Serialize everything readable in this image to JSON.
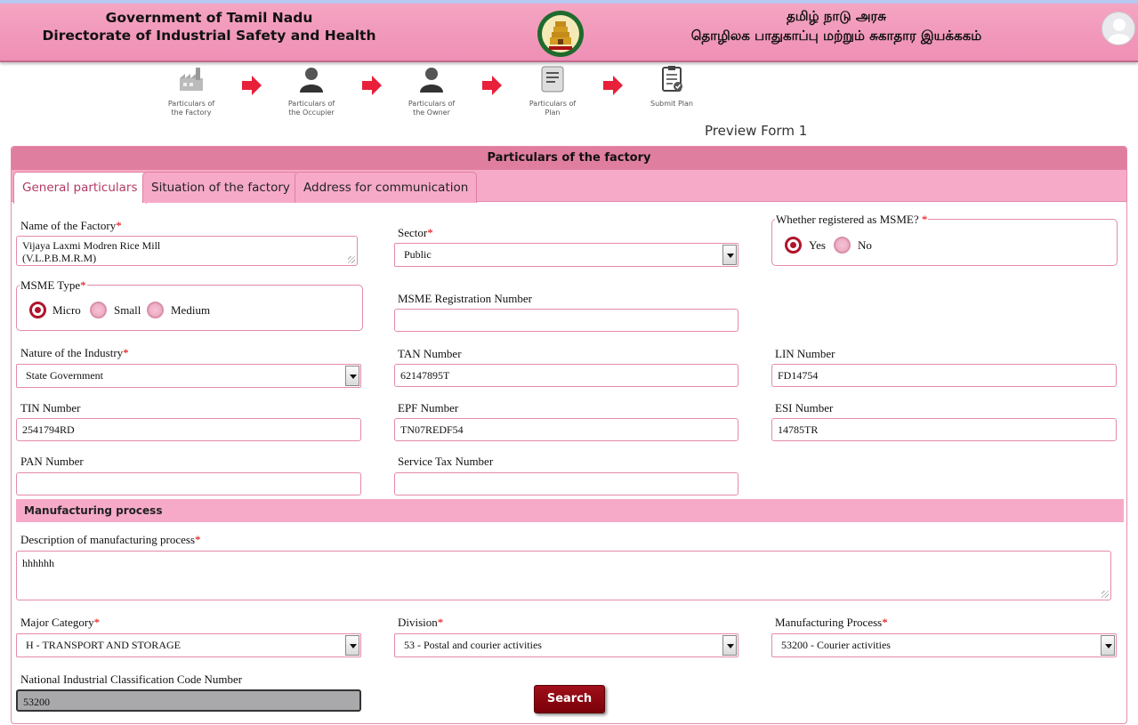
{
  "header": {
    "title_en_line1": "Government of Tamil Nadu",
    "title_en_line2": "Directorate of Industrial Safety and Health",
    "title_ta_line1": "தமிழ் நாடு அரசு",
    "title_ta_line2": "தொழிலக பாதுகாப்பு மற்றும் சுகாதார இயக்ககம்"
  },
  "steps": [
    {
      "line1": "Particulars of",
      "line2": "the Factory",
      "icon": "factory-icon"
    },
    {
      "line1": "Particulars of",
      "line2": "the Occupier",
      "icon": "user-icon"
    },
    {
      "line1": "Particulars of",
      "line2": "the Owner",
      "icon": "user-icon"
    },
    {
      "line1": "Particulars of",
      "line2": "Plan",
      "icon": "plan-icon"
    },
    {
      "line1": "Submit Plan",
      "line2": "",
      "icon": "clipboard-check-icon"
    }
  ],
  "preview_label": "Preview Form 1",
  "panel_title": "Particulars of the factory",
  "tabs": [
    {
      "label": "General particulars",
      "active": true
    },
    {
      "label": "Situation of the factory",
      "active": false
    },
    {
      "label": "Address for communication",
      "active": false
    }
  ],
  "form": {
    "factory_name": {
      "label": "Name of the Factory",
      "line1": "Vijaya Laxmi Modren Rice Mill",
      "line2": "(V.L.P.B.M.R.M)"
    },
    "sector": {
      "label": "Sector",
      "value": "Public"
    },
    "msme_registered": {
      "label": "Whether registered as MSME? ",
      "yes": "Yes",
      "no": "No",
      "selected": "Yes"
    },
    "msme_type": {
      "label": "MSME Type",
      "options": [
        "Micro",
        "Small",
        "Medium"
      ],
      "selected": "Micro"
    },
    "msme_reg_no": {
      "label": "MSME Registration Number",
      "value": ""
    },
    "nature": {
      "label": "Nature of the Industry",
      "value": "State Government"
    },
    "tan": {
      "label": "TAN Number",
      "value": "62147895T"
    },
    "lin": {
      "label": "LIN Number",
      "value": "FD14754"
    },
    "tin": {
      "label": "TIN Number",
      "value": "2541794RD"
    },
    "epf": {
      "label": "EPF Number",
      "value": "TN07REDF54"
    },
    "esi": {
      "label": "ESI Number",
      "value": "14785TR"
    },
    "pan": {
      "label": "PAN Number",
      "value": ""
    },
    "service_tax": {
      "label": "Service Tax Number",
      "value": ""
    }
  },
  "manufacturing": {
    "section_title": "Manufacturing process",
    "description": {
      "label": "Description of manufacturing process",
      "value": "hhhhhh"
    },
    "major_category": {
      "label": "Major Category",
      "value": "H - TRANSPORT AND STORAGE"
    },
    "division": {
      "label": "Division",
      "value": "53 - Postal and courier activities"
    },
    "process": {
      "label": "Manufacturing Process",
      "value": "53200 - Courier activities"
    },
    "nic": {
      "label": "National Industrial Classification Code Number",
      "value": "53200"
    },
    "search_label": "Search"
  },
  "colors": {
    "header_pink": "#ef8fb5",
    "accent_maroon": "#8a0a12",
    "tab_pink": "#f6aac8"
  }
}
